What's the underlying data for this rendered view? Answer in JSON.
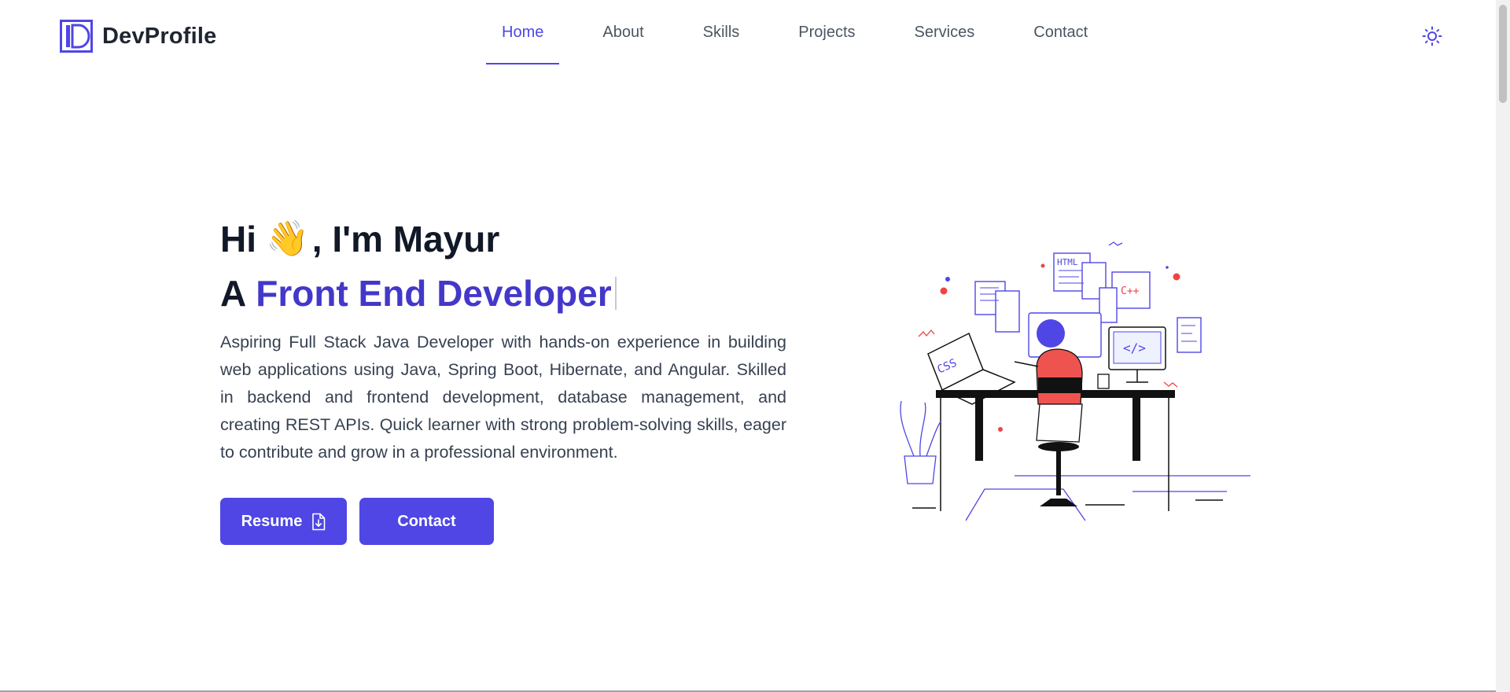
{
  "brand": {
    "name": "DevProfile",
    "logo_icon": "logo-d-icon"
  },
  "nav": {
    "items": [
      {
        "label": "Home",
        "active": true
      },
      {
        "label": "About",
        "active": false
      },
      {
        "label": "Skills",
        "active": false
      },
      {
        "label": "Projects",
        "active": false
      },
      {
        "label": "Services",
        "active": false
      },
      {
        "label": "Contact",
        "active": false
      }
    ],
    "theme_icon": "sun-icon"
  },
  "hero": {
    "greeting_prefix": "Hi",
    "wave_emoji": "👋",
    "greeting_suffix": ", I'm Mayur",
    "role_prefix": "A",
    "role": "Front End Developer",
    "bio": "Aspiring Full Stack Java Developer with hands-on experience in building web applications using Java, Spring Boot, Hibernate, and Angular. Skilled in backend and frontend development, database management, and creating REST APIs. Quick learner with strong problem-solving skills, eager to contribute and grow in a professional environment.",
    "buttons": {
      "resume_label": "Resume",
      "resume_icon": "file-download-icon",
      "contact_label": "Contact"
    }
  },
  "illustration": {
    "labels": {
      "html": "HTML",
      "cpp": "C++",
      "css": "CSS",
      "code": "</>"
    }
  },
  "colors": {
    "accent": "#4f46e5",
    "accent_dark": "#4338ca",
    "text_dark": "#111827",
    "text_body": "#374151",
    "nav_text": "#4b5563"
  }
}
